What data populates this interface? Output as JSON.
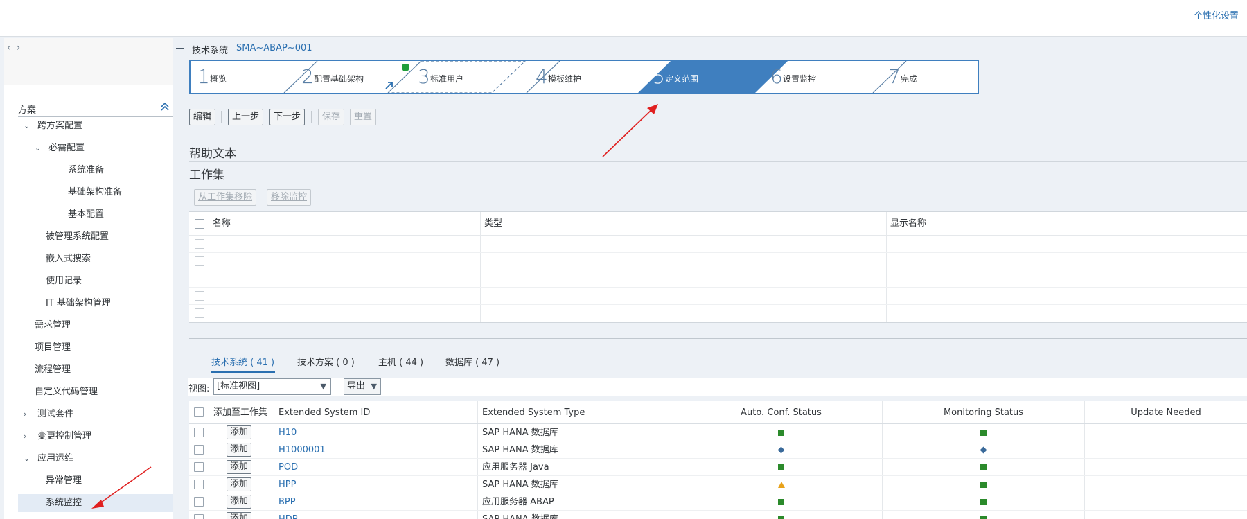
{
  "shell": {
    "personalize_label": "个性化设置"
  },
  "nav": {
    "back_glyph": "‹",
    "forward_glyph": "›",
    "section_title": "方案",
    "items": [
      {
        "label": "跨方案配置",
        "expanded": true
      },
      {
        "label": "必需配置",
        "expanded": true
      },
      {
        "label": "系统准备"
      },
      {
        "label": "基础架构准备"
      },
      {
        "label": "基本配置"
      },
      {
        "label": "被管理系统配置"
      },
      {
        "label": "嵌入式搜索"
      },
      {
        "label": "使用记录"
      },
      {
        "label": "IT 基础架构管理"
      },
      {
        "label": "需求管理"
      },
      {
        "label": "项目管理"
      },
      {
        "label": "流程管理"
      },
      {
        "label": "自定义代码管理"
      },
      {
        "label": "测试套件",
        "expanded": false
      },
      {
        "label": "变更控制管理",
        "expanded": false
      },
      {
        "label": "应用运维",
        "expanded": true
      },
      {
        "label": "异常管理"
      },
      {
        "label": "系统监控",
        "selected": true
      }
    ]
  },
  "header": {
    "label": "技术系统",
    "value": "SMA~ABAP~001"
  },
  "wizard": {
    "steps": [
      {
        "num": "1",
        "label": "概览"
      },
      {
        "num": "2",
        "label": "配置基础架构"
      },
      {
        "num": "3",
        "label": "标准用户"
      },
      {
        "num": "4",
        "label": "模板维护"
      },
      {
        "num": "5",
        "label": "定义范围",
        "active": true
      },
      {
        "num": "6",
        "label": "设置监控"
      },
      {
        "num": "7",
        "label": "完成"
      }
    ],
    "active_color": "#3f7fbf"
  },
  "toolbar": {
    "edit": "编辑",
    "prev": "上一步",
    "next": "下一步",
    "save": "保存",
    "reset": "重置"
  },
  "help_text_title": "帮助文本",
  "working_set": {
    "title": "工作集",
    "remove_from_set": "从工作集移除",
    "remove_monitoring": "移除监控",
    "columns": [
      "名称",
      "类型",
      "显示名称"
    ]
  },
  "tabs": [
    {
      "label": "技术系统 ( 41 )",
      "active": true
    },
    {
      "label": "技术方案 ( 0 )"
    },
    {
      "label": "主机 ( 44 )"
    },
    {
      "label": "数据库 ( 47 )"
    }
  ],
  "view": {
    "label": "视图:",
    "selected": "[标准视图]",
    "export": "导出"
  },
  "systems": {
    "columns": [
      "添加至工作集",
      "Extended System ID",
      "Extended System Type",
      "Auto. Conf. Status",
      "Monitoring Status",
      "Update Needed"
    ],
    "add_label": "添加",
    "rows": [
      {
        "id": "H10",
        "type": "SAP HANA 数据库",
        "auto": "ok",
        "mon": "ok"
      },
      {
        "id": "H1000001",
        "type": "SAP HANA 数据库",
        "auto": "diamond",
        "mon": "diamond"
      },
      {
        "id": "POD",
        "type": "应用服务器 Java",
        "auto": "ok",
        "mon": "ok"
      },
      {
        "id": "HPP",
        "type": "SAP HANA 数据库",
        "auto": "warn",
        "mon": "ok"
      },
      {
        "id": "BPP",
        "type": "应用服务器 ABAP",
        "auto": "ok",
        "mon": "ok"
      },
      {
        "id": "HDP",
        "type": "SAP HANA 数据库",
        "auto": "ok",
        "mon": "ok"
      }
    ]
  }
}
